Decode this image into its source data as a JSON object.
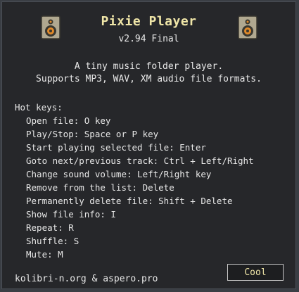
{
  "app": {
    "title": "Pixie Player",
    "version": "v2.94 Final"
  },
  "description": {
    "line1": "A tiny music folder player.",
    "line2": "Supports MP3, WAV, XM audio file formats."
  },
  "hotkeys": {
    "heading": "Hot keys:",
    "items": [
      "Open file: O key",
      "Play/Stop: Space or P key",
      "Start playing selected file: Enter",
      "Goto next/previous track: Ctrl + Left/Right",
      "Change sound volume: Left/Right key",
      "Remove from the list: Delete",
      "Permanently delete file: Shift + Delete",
      "Show file info: I",
      "Repeat: R",
      "Shuffle: S",
      "Mute: M"
    ]
  },
  "footer": {
    "credits": "kolibri-n.org & aspero.pro"
  },
  "buttons": {
    "cool": "Cool"
  },
  "icons": {
    "left": "speaker-icon",
    "right": "speaker-icon"
  },
  "colors": {
    "title": "#f0e6a8",
    "background": "#26272a",
    "speaker_body": "#b0a890",
    "speaker_cone": "#e08a2a"
  }
}
